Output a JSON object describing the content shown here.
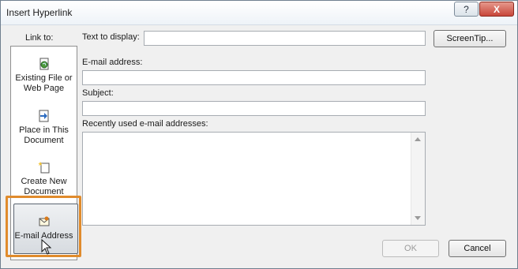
{
  "window": {
    "title": "Insert Hyperlink",
    "help_glyph": "?",
    "close_glyph": "X"
  },
  "link_to": {
    "label": "Link to:",
    "items": [
      {
        "line1": "Existing File or",
        "line2": "Web Page",
        "icon": "existing-file-icon"
      },
      {
        "line1": "Place in This",
        "line2": "Document",
        "icon": "place-in-document-icon"
      },
      {
        "line1": "Create New",
        "line2": "Document",
        "icon": "create-new-document-icon"
      },
      {
        "line1": "E-mail Address",
        "line2": "",
        "icon": "email-address-icon"
      }
    ],
    "selected_index": 3
  },
  "fields": {
    "text_to_display": {
      "label": "Text to display:",
      "value": ""
    },
    "screentip": {
      "label": "ScreenTip..."
    },
    "email": {
      "label": "E-mail address:",
      "value": ""
    },
    "subject": {
      "label": "Subject:",
      "value": ""
    },
    "recent": {
      "label": "Recently used e-mail addresses:",
      "items": []
    }
  },
  "buttons": {
    "ok": "OK",
    "cancel": "Cancel"
  },
  "colors": {
    "highlight": "#e08b2c",
    "close": "#c8473a"
  }
}
